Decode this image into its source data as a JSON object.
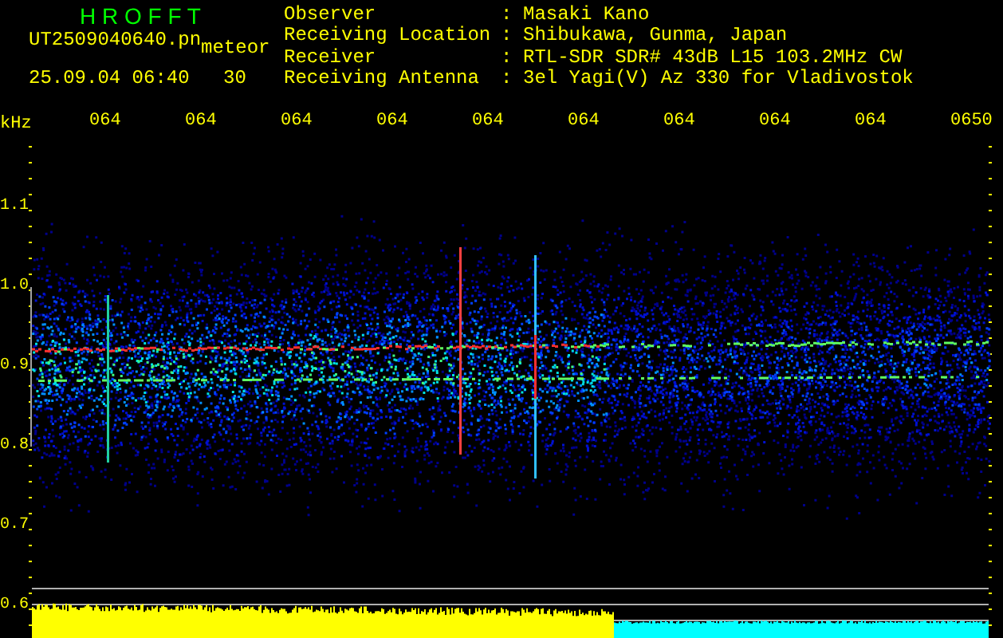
{
  "header": {
    "title": "H R O F F T",
    "file_name": "UT2509040640.pn",
    "type": "meteor",
    "timestamp": "25.09.04 06:40",
    "count": "30"
  },
  "info": [
    {
      "label": "Observer",
      "separator": ":",
      "value": "Masaki Kano"
    },
    {
      "label": "Receiving Location",
      "separator": ":",
      "value": "Shibukawa, Gunma, Japan"
    },
    {
      "label": "Receiver",
      "separator": ":",
      "value": "RTL-SDR SDR# 43dB L15 103.2MHz CW"
    },
    {
      "label": "Receiving Antenna",
      "separator": ":",
      "value": "3el Yagi(V) Az 330 for Vladivostok"
    }
  ],
  "plot": {
    "y_unit": "kHz",
    "y_labels": [
      "1.1",
      "1.0",
      "0.9",
      "0.8",
      "0.7",
      "0.6"
    ],
    "x_labels": [
      "064",
      "064",
      "064",
      "064",
      "064",
      "064",
      "064",
      "064",
      "064",
      "0650"
    ]
  }
}
